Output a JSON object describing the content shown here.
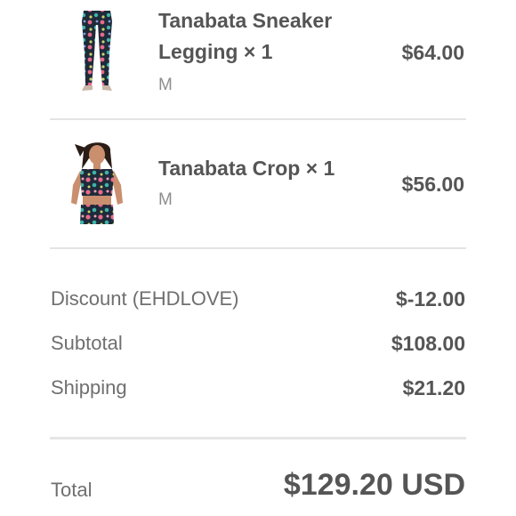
{
  "cart": {
    "items": [
      {
        "name_line1": "Tanabata Sneaker",
        "name_line2": "Legging × 1",
        "variant": "M",
        "price": "$64.00"
      },
      {
        "name": "Tanabata Crop × 1",
        "variant": "M",
        "price": "$56.00"
      }
    ]
  },
  "summary": {
    "discount_label": "Discount (EHDLOVE)",
    "discount_value": "$-12.00",
    "subtotal_label": "Subtotal",
    "subtotal_value": "$108.00",
    "shipping_label": "Shipping",
    "shipping_value": "$21.20"
  },
  "total": {
    "label": "Total",
    "value": "$129.20 USD"
  },
  "colors": {
    "text": "#555555",
    "muted": "#8e8e8e",
    "divider": "#e4e4e4",
    "print_navy": "#1f2a3a",
    "print_pink": "#e86a8a",
    "print_teal": "#3fb3a8"
  }
}
